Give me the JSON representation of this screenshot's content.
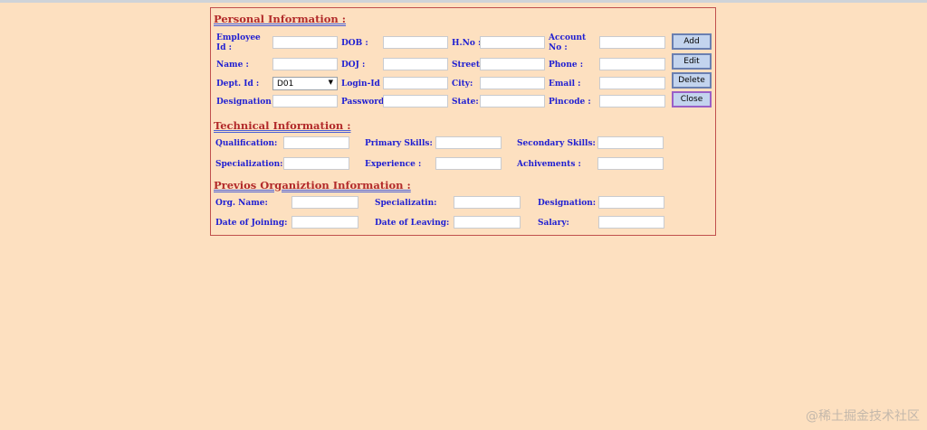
{
  "personal": {
    "title": "Personal Information :",
    "employee_id": "Employee Id :",
    "dob": "DOB :",
    "hno": "H.No :",
    "account_no": "Account No :",
    "name": "Name :",
    "doj": "DOJ :",
    "street": "Street:",
    "phone": "Phone :",
    "dept_id": "Dept. Id :",
    "dept_value": "D01",
    "login_id": "Login-Id :",
    "city": "City:",
    "email": "Email :",
    "designation": "Designation :",
    "password": "Password:",
    "state": "State:",
    "pincode": "Pincode :"
  },
  "buttons": {
    "add": "Add",
    "edit": "Edit",
    "delete": "Delete",
    "close": "Close"
  },
  "technical": {
    "title": "Technical Information :",
    "qualification": "Qualification:",
    "primary_skills": "Primary Skills:",
    "secondary_skills": "Secondary Skills:",
    "specialization": "Specialization:",
    "experience": "Experience :",
    "achivements": "Achivements :"
  },
  "previous": {
    "title": "Previos Organiztion Information :",
    "org_name": "Org. Name:",
    "specializatin": "Specializatin:",
    "designation": "Designation:",
    "date_joining": "Date of Joining:",
    "date_leaving": "Date of Leaving:",
    "salary": "Salary:"
  },
  "watermark": "@稀土掘金技术社区"
}
